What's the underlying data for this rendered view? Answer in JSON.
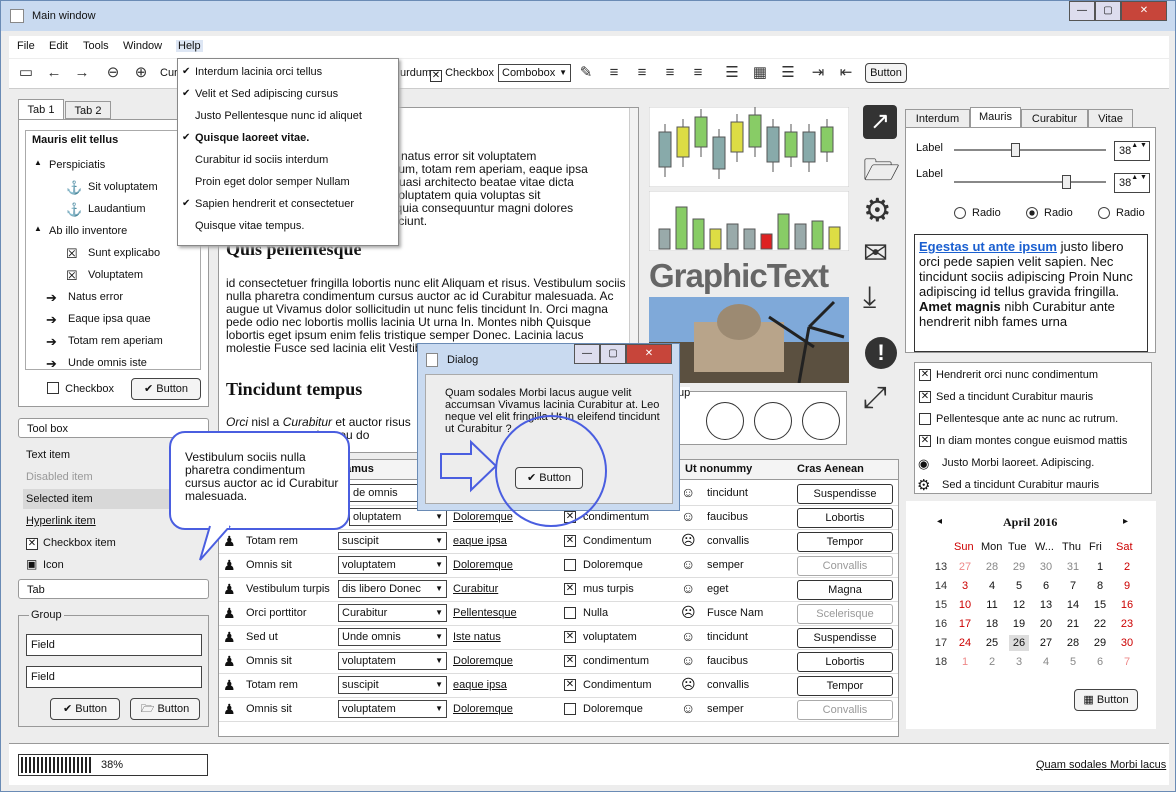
{
  "window": {
    "title": "Main window"
  },
  "menubar": {
    "items": [
      "File",
      "Edit",
      "Tools",
      "Window",
      "Help"
    ]
  },
  "toolbar": {
    "cur_label": "Cur",
    "urdum_label": "urdum",
    "checkbox_label": "Checkbox",
    "combobox_value": "Combobox",
    "button_label": "Button"
  },
  "help_menu": {
    "items": [
      {
        "label": "Interdum lacinia orci tellus",
        "checked": true
      },
      {
        "label": "Velit et Sed adipiscing cursus",
        "checked": true
      },
      {
        "label": "Justo Pellentesque nunc id aliquet",
        "checked": false
      },
      {
        "label": "Quisque laoreet vitae.",
        "checked": true
      },
      {
        "label": "Curabitur id sociis interdum",
        "checked": false
      },
      {
        "label": "Proin eget dolor semper Nullam",
        "checked": false
      },
      {
        "label": "Sapien hendrerit et consectetuer",
        "checked": true
      },
      {
        "label": "Quisque vitae tempus.",
        "checked": false
      }
    ]
  },
  "left_tabs": {
    "tab1": "Tab 1",
    "tab2": "Tab 2"
  },
  "tree": {
    "header": "Mauris elit tellus",
    "items": [
      "Perspiciatis",
      "Sit voluptatem",
      "Laudantium",
      "Ab illo inventore",
      "Sunt explicabo",
      "Voluptatem",
      "Natus error",
      "Eaque ipsa quae",
      "Totam rem aperiam",
      "Unde omnis iste"
    ]
  },
  "left_bottom": {
    "checkbox": "Checkbox",
    "button": "Button"
  },
  "toolbox": {
    "title": "Tool box",
    "items": [
      "Text item",
      "Disabled item",
      "Selected item",
      "Hyperlink item",
      "Checkbox item",
      "Icon"
    ]
  },
  "tab_box": {
    "title": "Tab"
  },
  "group": {
    "title": "Group",
    "field1": "Field",
    "field2": "Field",
    "button1": "Button",
    "button2": "Button"
  },
  "doc": {
    "para1_l1": "iste natus error sit voluptatem",
    "para1_l2": "antium, totam rem aperiam, eaque ipsa",
    "para1_l3": "et quasi architecto beatae vitae dicta",
    "para1_l4": "m voluptatem quia voluptas sit",
    "para1_l5": "ed quia consequuntur magni dolores",
    "para1_l6": "nesciunt.",
    "heading1": "Quis pellentesque",
    "para2": "id consectetuer fringilla lobortis nunc elit Aliquam et risus. Vestibulum sociis nulla pharetra condimentum cursus auctor ac id Curabitur malesuada. Ac augue ut Vivamus dolor sollicitudin ut nunc felis tincidunt In. Orci magna pede odio nec lobortis mollis lacinia Ut urna In. Montes nibh Quisque lobortis eget ipsum enim felis tristique semper Donec. Lacinia lacus molestie Fusce sed lacinia elit Vestibulum turpis pretium vitae.",
    "heading2": "Tincidunt tempus",
    "para3_a": "Orci",
    "para3_b": " nisl a ",
    "para3_c": "Curabitur",
    "para3_d": " et auctor risus",
    "para3_e": "eturient eu do"
  },
  "graphic_text": "GraphicText",
  "group_circles_label": "up",
  "right_tabs": [
    "Interdum",
    "Mauris",
    "Curabitur",
    "Vitae"
  ],
  "sliders": [
    {
      "label": "Label",
      "value": "38",
      "level": 0.38
    },
    {
      "label": "Label",
      "value": "38",
      "level": 0.72
    }
  ],
  "radios": [
    {
      "label": "Radio",
      "checked": false
    },
    {
      "label": "Radio",
      "checked": true
    },
    {
      "label": "Radio",
      "checked": false
    }
  ],
  "rich_text": {
    "link": "Egestas ut ante ipsum",
    "t1": " justo libero orci pede sapien velit sapien. Nec tincidunt sociis adipiscing Proin Nunc adipiscing id tellus gravida fringilla. ",
    "bold": "Amet magnis",
    "t2": " nibh Curabitur ante hendrerit nibh fames urna"
  },
  "check_list": [
    {
      "label": "Hendrerit orci nunc condimentum",
      "type": "checked"
    },
    {
      "label": "Sed a tincidunt Curabitur mauris",
      "type": "checked"
    },
    {
      "label": "Pellentesque ante ac nunc ac rutrum.",
      "type": "unchecked"
    },
    {
      "label": "In diam montes congue euismod mattis",
      "type": "checked"
    },
    {
      "label": "Justo Morbi laoreet. Adipiscing.",
      "type": "icon"
    },
    {
      "label": "Sed a tincidunt Curabitur mauris",
      "type": "gear"
    }
  ],
  "calendar": {
    "month": "April 2016",
    "days": [
      "Sun",
      "Mon",
      "Tue",
      "W...",
      "Thu",
      "Fri",
      "Sat"
    ],
    "weeks": [
      [
        "13",
        "27",
        "28",
        "29",
        "30",
        "31",
        "1",
        "2"
      ],
      [
        "14",
        "3",
        "4",
        "5",
        "6",
        "7",
        "8",
        "9"
      ],
      [
        "15",
        "10",
        "11",
        "12",
        "13",
        "14",
        "15",
        "16"
      ],
      [
        "16",
        "17",
        "18",
        "19",
        "20",
        "21",
        "22",
        "23"
      ],
      [
        "17",
        "24",
        "25",
        "26",
        "27",
        "28",
        "29",
        "30"
      ],
      [
        "18",
        "1",
        "2",
        "3",
        "4",
        "5",
        "6",
        "7"
      ]
    ],
    "button": "Button"
  },
  "table": {
    "headers": [
      "",
      "vamus",
      "",
      "",
      "Ut nonummy",
      "Cras Aenean"
    ],
    "rows": [
      {
        "name": "",
        "combo": "de omnis",
        "link": "",
        "chk": "",
        "face": "smile",
        "word": "tincidunt",
        "btn": "Suspendisse"
      },
      {
        "name": "",
        "combo": "oluptatem",
        "link": "Doloremque",
        "chk": "condimentum",
        "face": "smile",
        "word": "faucibus",
        "btn": "Lobortis"
      },
      {
        "name": "Totam rem",
        "combo": "suscipit",
        "link": "eaque ipsa",
        "chk": "Condimentum",
        "face": "sad",
        "word": "convallis",
        "btn": "Tempor"
      },
      {
        "name": "Omnis sit",
        "combo": "voluptatem",
        "link": "Doloremque",
        "chk": "Doloremque",
        "face": "smile",
        "word": "semper",
        "btn": "Convallis"
      },
      {
        "name": "Vestibulum turpis",
        "combo": "dis libero Donec",
        "link": "Curabitur",
        "chk": "mus turpis",
        "face": "smile",
        "word": "eget",
        "btn": "Magna"
      },
      {
        "name": "Orci porttitor",
        "combo": "Curabitur",
        "link": "Pellentesque",
        "chk": "Nulla",
        "face": "sad",
        "word": "Fusce Nam",
        "btn": "Scelerisque"
      },
      {
        "name": "Sed ut",
        "combo": "Unde omnis",
        "link": "Iste natus",
        "chk": "voluptatem",
        "face": "smile",
        "word": "tincidunt",
        "btn": "Suspendisse"
      },
      {
        "name": "Omnis sit",
        "combo": "voluptatem",
        "link": "Doloremque",
        "chk": "condimentum",
        "face": "smile",
        "word": "faucibus",
        "btn": "Lobortis"
      },
      {
        "name": "Totam rem",
        "combo": "suscipit",
        "link": "eaque ipsa",
        "chk": "Condimentum",
        "face": "sad",
        "word": "convallis",
        "btn": "Tempor"
      },
      {
        "name": "Omnis sit",
        "combo": "voluptatem",
        "link": "Doloremque",
        "chk": "Doloremque",
        "face": "smile",
        "word": "semper",
        "btn": "Convallis"
      }
    ]
  },
  "dialog": {
    "title": "Dialog",
    "text": "Quam sodales Morbi lacus augue velit accumsan Vivamus lacinia Curabitur at. Leo neque vel elit fringilla Ut In eleifend tincidunt ut Curabitur ?",
    "button": "Button"
  },
  "bubble": {
    "text": "Vestibulum sociis nulla pharetra condimentum cursus auctor ac id Curabitur malesuada."
  },
  "status": {
    "progress_label": "38%",
    "progress": 0.38,
    "link": "Quam sodales Morbi lacus"
  }
}
